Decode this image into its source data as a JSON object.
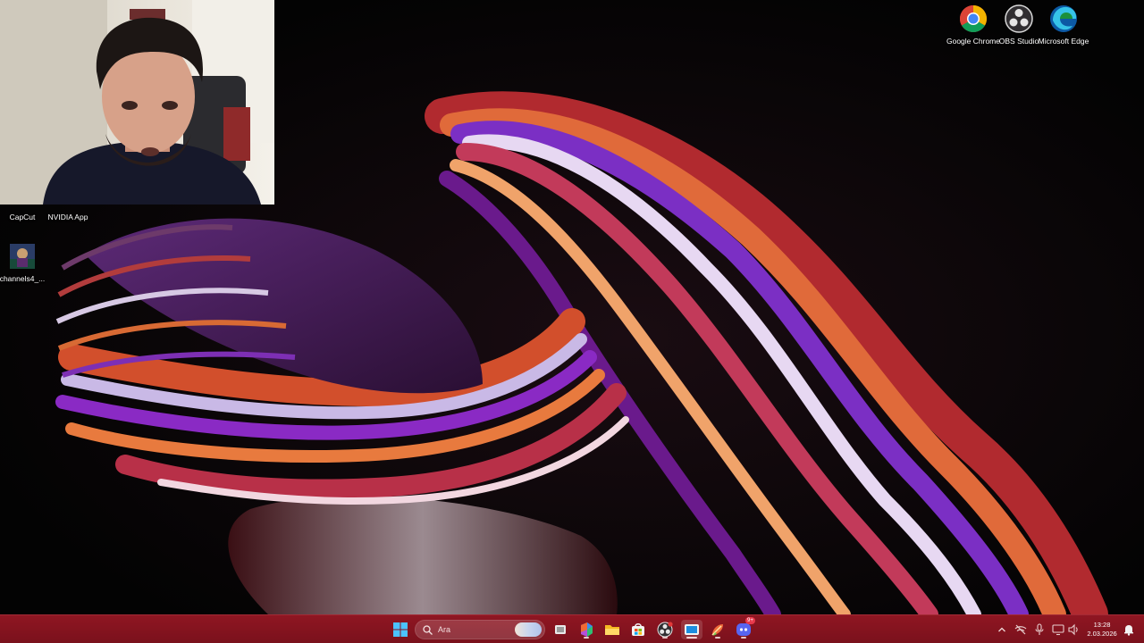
{
  "desktop": {
    "icons": [
      {
        "label": "Google Chrome",
        "icon": "chrome-icon"
      },
      {
        "label": "OBS Studio",
        "icon": "obs-icon"
      },
      {
        "label": "Microsoft Edge",
        "icon": "edge-icon"
      },
      {
        "label": "CapCut",
        "icon": "capcut-icon"
      },
      {
        "label": "NVIDIA App",
        "icon": "nvidia-icon"
      },
      {
        "label": "channels4_...",
        "icon": "image-file-icon"
      }
    ]
  },
  "taskbar": {
    "search_placeholder": "Ara",
    "pinned": [
      "start-icon",
      "search-icon",
      "task-view-icon",
      "microsoft365-icon",
      "file-explorer-icon",
      "microsoft-store-icon",
      "obs-icon",
      "capcut-icon",
      "chrome-rocket-icon",
      "discord-icon"
    ],
    "discord_badge": "9+",
    "tray": [
      "chevron-up-icon",
      "network-off-icon",
      "microphone-icon",
      "display-icon",
      "speaker-icon"
    ],
    "clock": {
      "time": "13:28",
      "date": "2.03.2026"
    }
  },
  "colors": {
    "taskbar": "#8a1520",
    "accent": "#b32638"
  }
}
